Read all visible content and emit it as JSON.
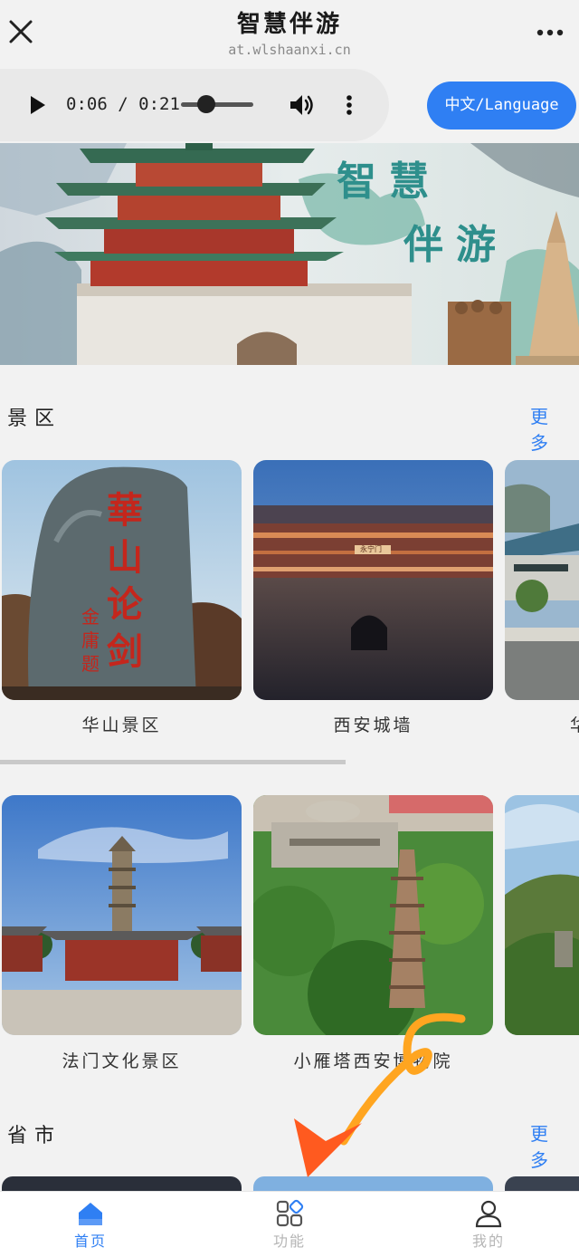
{
  "header": {
    "title": "智慧伴游",
    "url": "at.wlshaanxi.cn"
  },
  "audio": {
    "current_time": "0:06",
    "separator": "/",
    "duration": "0:21",
    "progress": 0.29
  },
  "language_button": "中文/Language",
  "banner": {
    "text_line1": "智慧",
    "text_line2": "伴游"
  },
  "scenic": {
    "title": "景区",
    "more": "更多",
    "row1": [
      {
        "label": "华山景区",
        "rock_text": "華山论剑",
        "rock_side": "金庸题"
      },
      {
        "label": "西安城墙",
        "sign": "永宁门"
      },
      {
        "label": "华"
      }
    ],
    "row2": [
      {
        "label": "法门文化景区"
      },
      {
        "label": "小雁塔西安博物院"
      },
      {
        "label": ""
      }
    ]
  },
  "province": {
    "title": "省市",
    "more": "更多"
  },
  "tabbar": {
    "items": [
      {
        "label": "首页",
        "icon": "home-icon",
        "active": true
      },
      {
        "label": "功能",
        "icon": "grid-icon",
        "active": false
      },
      {
        "label": "我的",
        "icon": "user-icon",
        "active": false
      }
    ]
  },
  "colors": {
    "accent": "#2f7ff3",
    "annotation_arrow": "#ff5a1f",
    "inactive_tab": "#b5b5b5"
  }
}
